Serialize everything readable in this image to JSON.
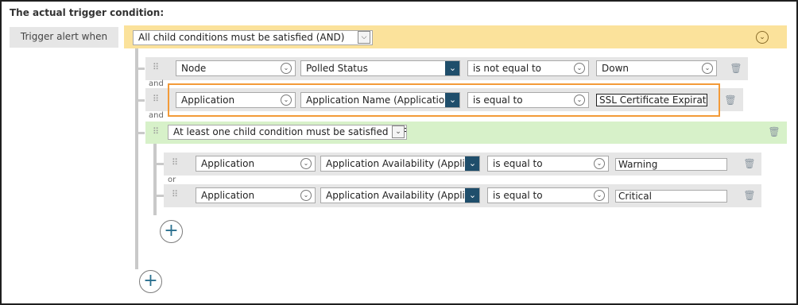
{
  "heading": "The actual trigger condition:",
  "trigger_label": "Trigger alert when",
  "root_group": {
    "mode": "All child conditions must be satisfied (AND)",
    "accent_color": "#fbe29b"
  },
  "join_and": "and",
  "join_or": "or",
  "conditions": [
    {
      "object": "Node",
      "property": "Polled Status",
      "operator": "is not equal to",
      "value": "Down"
    },
    {
      "object": "Application",
      "property": "Application Name (Application Alias)",
      "operator": "is equal to",
      "value": "SSL Certificate Expiration"
    }
  ],
  "sub_group": {
    "mode": "At least one child condition must be satisfied (OR)",
    "accent_color": "#d7f1c9",
    "conditions": [
      {
        "object": "Application",
        "property": "Application Availability (Application)",
        "operator": "is equal to",
        "value": "Warning"
      },
      {
        "object": "Application",
        "property": "Application Availability (Application)",
        "operator": "is equal to",
        "value": "Critical"
      }
    ]
  },
  "icons": {
    "drag": "drag-handle-icon",
    "trash": "trash-icon",
    "chevron": "chevron-down-icon",
    "plus": "plus-icon"
  },
  "highlight_color": "#f39a38"
}
